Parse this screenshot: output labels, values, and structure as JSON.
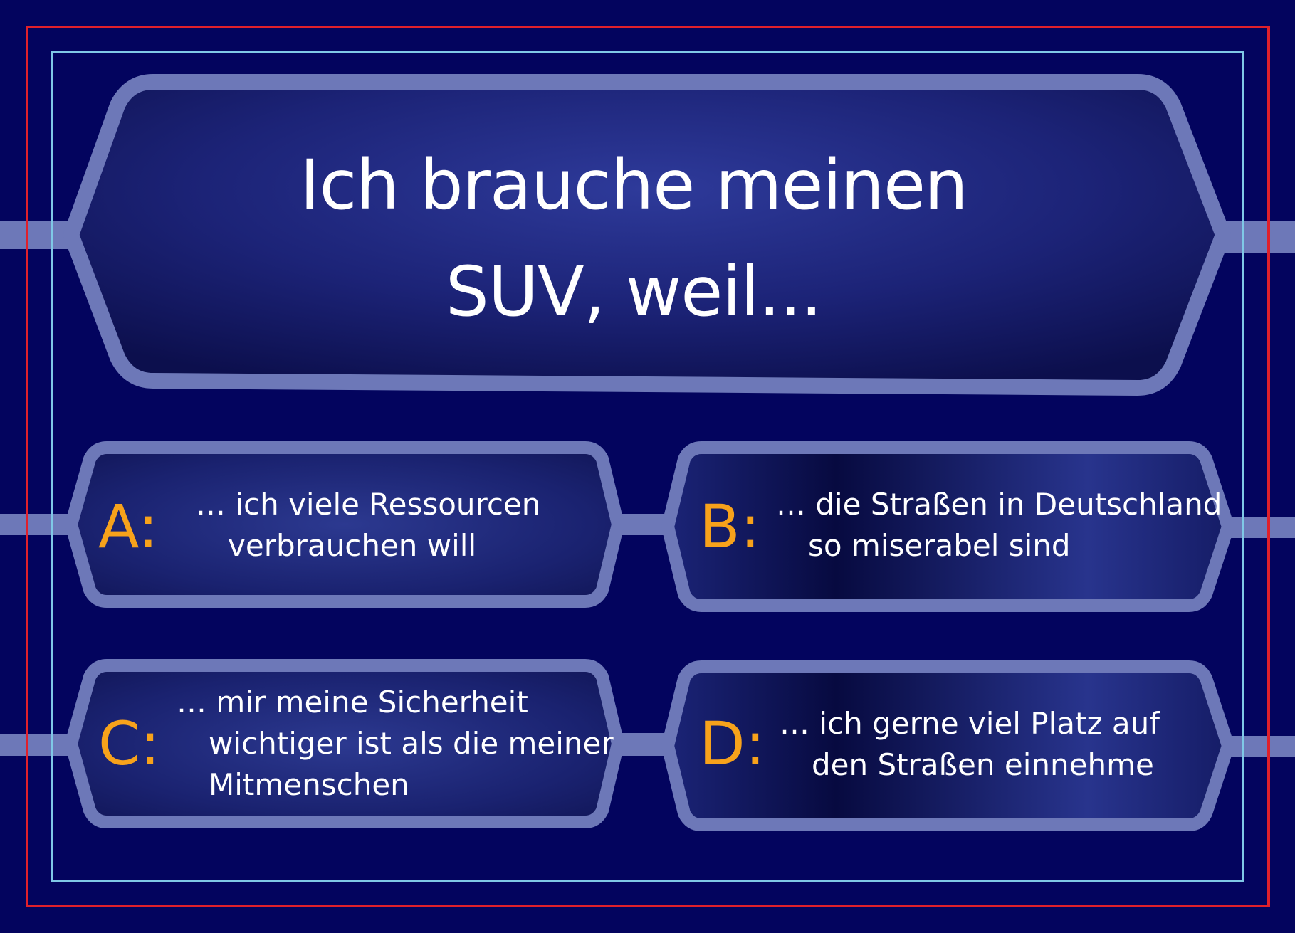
{
  "question": {
    "line1": "Ich brauche meinen",
    "line2": "SUV, weil..."
  },
  "answers": [
    {
      "letter": "A:",
      "lines": [
        "… ich viele Ressourcen",
        "verbrauchen will"
      ]
    },
    {
      "letter": "B:",
      "lines": [
        "… die Straßen in Deutschland",
        "so miserabel sind"
      ]
    },
    {
      "letter": "C:",
      "lines": [
        "… mir meine Sicherheit",
        "wichtiger ist als die meiner",
        "Mitmenschen"
      ]
    },
    {
      "letter": "D:",
      "lines": [
        "… ich gerne viel Platz auf",
        "den Straßen einnehme"
      ]
    }
  ],
  "colors": {
    "background": "#03045e",
    "frame_outer": "#e0202b",
    "frame_inner": "#7fc8e6",
    "panel_border": "#6d78b8",
    "letter": "#f7a21b",
    "text": "#ffffff"
  }
}
